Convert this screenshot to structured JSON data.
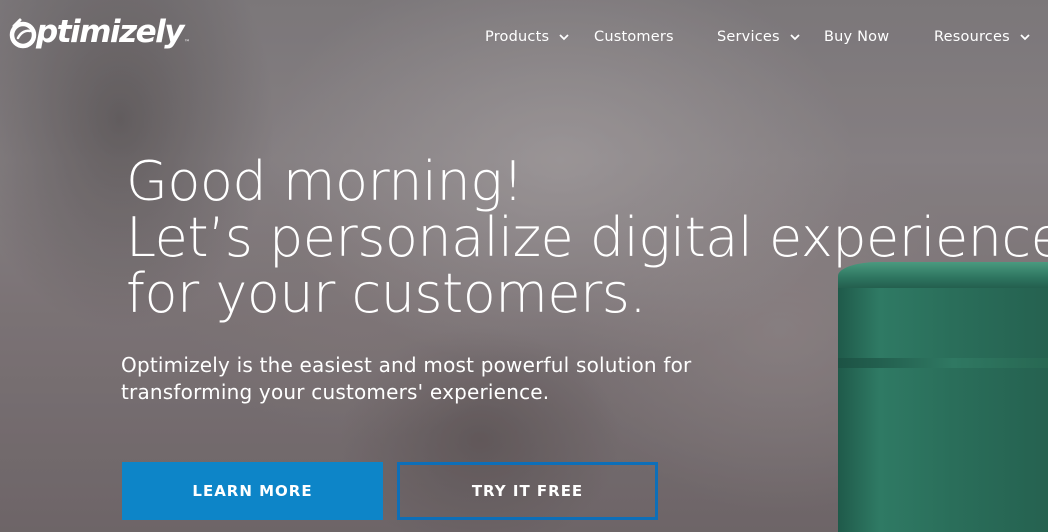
{
  "brand": {
    "name": "Optimizely",
    "logo_text": "ptimizely",
    "trademark": "™"
  },
  "nav": {
    "items": [
      {
        "label": "Products",
        "has_dropdown": true
      },
      {
        "label": "Customers",
        "has_dropdown": false
      },
      {
        "label": "Services",
        "has_dropdown": true
      },
      {
        "label": "Buy Now",
        "has_dropdown": false
      },
      {
        "label": "Resources",
        "has_dropdown": true
      }
    ]
  },
  "hero": {
    "headline_lines": [
      "Good morning!",
      "Let’s personalize digital experiences",
      "for your customers."
    ],
    "subhead_lines": [
      "Optimizely is the easiest and most powerful solution for",
      "transforming your customers' experience."
    ],
    "primary_button": "LEARN MORE",
    "secondary_button": "TRY IT FREE"
  },
  "colors": {
    "primary_button": "#0d85c8",
    "outline_button_border": "#0d6fb8",
    "text": "#ffffff"
  },
  "icons": {
    "dropdown": "chevron-down-icon",
    "logo_mark": "optimizely-o-icon"
  }
}
